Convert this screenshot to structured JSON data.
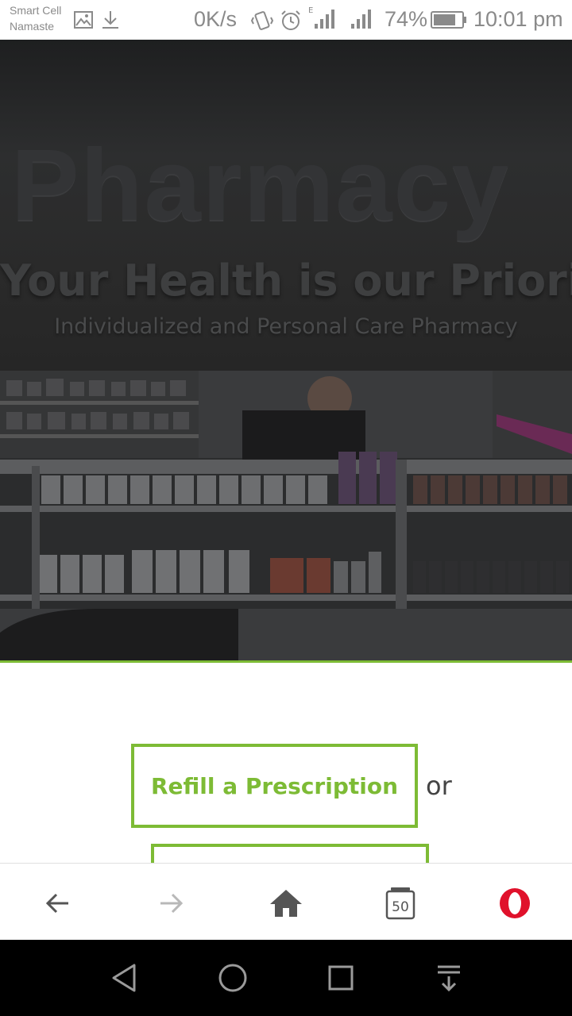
{
  "status_bar": {
    "carrier_line1": "Smart Cell",
    "carrier_line2": "Namaste",
    "net_speed": "0K/s",
    "network_type": "E",
    "battery": "74%",
    "time": "10:01 pm",
    "icons": [
      "image-icon",
      "download-icon",
      "vibrate-icon",
      "alarm-icon",
      "signal-icon",
      "signal-icon",
      "battery-icon"
    ]
  },
  "hero": {
    "sign_text": "Pharmacy",
    "title": "Your Health is our Priority",
    "subtitle": "Individualized and Personal Care Pharmacy"
  },
  "content": {
    "refill_button": "Refill a Prescription",
    "or_text": "or"
  },
  "browser_bar": {
    "tabs_count": "50",
    "icons": [
      "back-arrow-icon",
      "forward-arrow-icon",
      "home-icon",
      "tabs-icon",
      "opera-icon"
    ]
  },
  "nav_bar": {
    "icons": [
      "back-triangle-icon",
      "home-circle-icon",
      "recents-square-icon",
      "notification-pull-icon"
    ]
  },
  "colors": {
    "accent": "#7dbb35",
    "opera_red": "#e0112b",
    "status_text": "#8a8a8a"
  }
}
